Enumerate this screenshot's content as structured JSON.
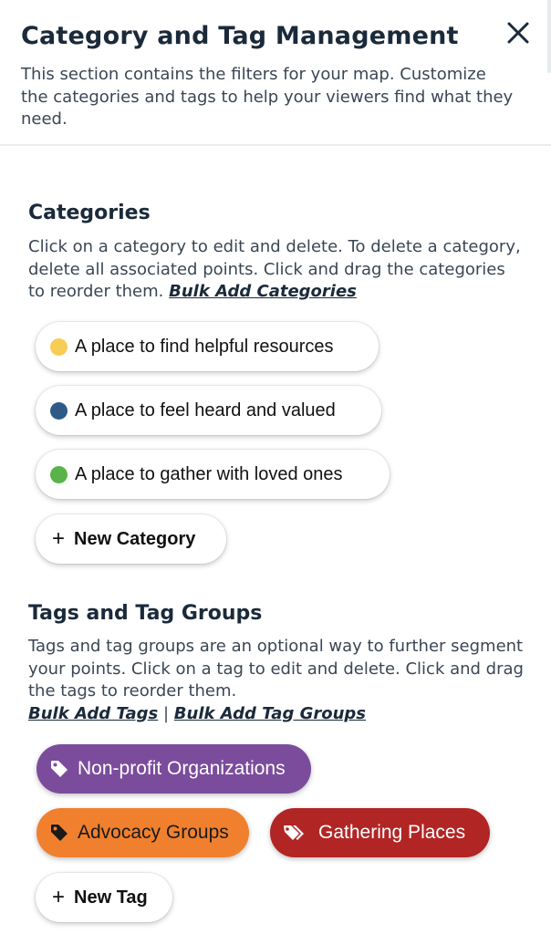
{
  "header": {
    "title": "Category and Tag Management",
    "description": "This section contains the filters for your map. Customize the categories and tags to help your viewers find what they need."
  },
  "categories": {
    "title": "Categories",
    "description": "Click on a category to edit and delete. To delete a category, delete all associated points. Click and drag the categories to reorder them.",
    "bulk_link": "Bulk Add Categories",
    "items": [
      {
        "label": "A place to find helpful resources",
        "color": "#f7cd56"
      },
      {
        "label": "A place to feel heard and valued",
        "color": "#2e5a87"
      },
      {
        "label": "A place to gather with loved ones",
        "color": "#5ab348"
      }
    ],
    "new_label": "New Category"
  },
  "tags": {
    "title": "Tags and Tag Groups",
    "description": "Tags and tag groups are an optional way to further segment your points. Click on a tag to edit and delete. Click and drag the tags to reorder them.",
    "bulk_tags_link": "Bulk Add Tags",
    "separator": "|",
    "bulk_groups_link": "Bulk Add Tag Groups",
    "items": [
      {
        "label": "Non-profit Organizations",
        "color": "#7b4c9c",
        "text_color": "#ffffff",
        "icon": "tag-icon"
      },
      {
        "label": "Advocacy Groups",
        "color": "#f0802e",
        "text_color": "#1a1a1a",
        "icon": "tag-icon"
      },
      {
        "label": "Gathering Places",
        "color": "#b22525",
        "text_color": "#ffffff",
        "icon": "tags-icon"
      }
    ],
    "new_label": "New Tag"
  }
}
